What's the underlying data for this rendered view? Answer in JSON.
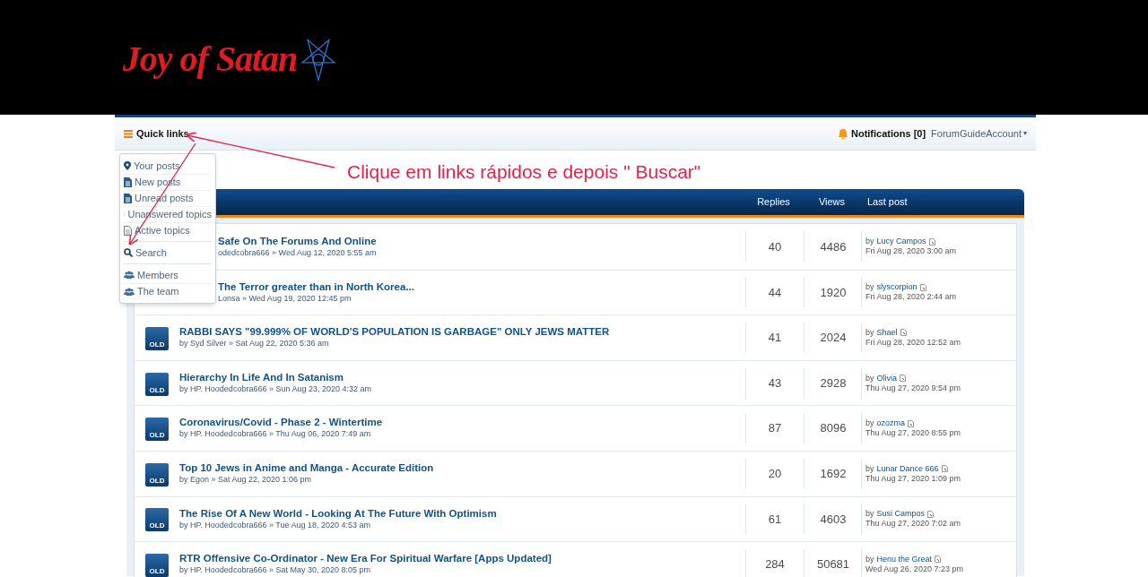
{
  "logo": {
    "text": "Joy of Satan"
  },
  "navbar": {
    "quick_links": "Quick links",
    "notifications": "Notifications [0]",
    "account": "ForumGuideAccount",
    "account_caret": "▾"
  },
  "quick_links_menu": {
    "groups": [
      [
        {
          "label": "Your posts",
          "kind": "pin"
        },
        {
          "label": "New posts",
          "kind": "filled"
        },
        {
          "label": "Unread posts",
          "kind": "filled"
        },
        {
          "label": "Unanswered topics",
          "kind": "outline"
        },
        {
          "label": "Active topics",
          "kind": "lines"
        }
      ],
      [
        {
          "label": "Search",
          "kind": "search"
        }
      ],
      [
        {
          "label": "Members",
          "kind": "users"
        },
        {
          "label": "The team",
          "kind": "users"
        }
      ]
    ]
  },
  "annotation": {
    "text": "Clique em links rápidos e depois \" Buscar\""
  },
  "table": {
    "columns": [
      "Replies",
      "Views",
      "Last post"
    ],
    "rows": [
      {
        "kind": "covered",
        "title": "Safe On The Forums And Online",
        "byline": "odedcobra666 » Wed Aug 12, 2020 5:55 am",
        "replies": "40",
        "views": "4486",
        "last_by": "by",
        "last_author": "Lucy Campos",
        "last_date": "Fri Aug 28, 2020 3:00 am"
      },
      {
        "kind": "covered",
        "title": "The Terror greater than in North Korea...",
        "byline": "Lonsa » Wed Aug 19, 2020 12:45 pm",
        "replies": "44",
        "views": "1920",
        "last_by": "by",
        "last_author": "slyscorpion",
        "last_date": "Fri Aug 28, 2020 2:44 am"
      },
      {
        "kind": "full",
        "badge": "OLD",
        "title": "RABBI SAYS \"99.999% OF WORLD'S POPULATION IS GARBAGE\" ONLY JEWS MATTER",
        "byline": "by Syd Silver » Sat Aug 22, 2020 5:36 am",
        "replies": "41",
        "views": "2024",
        "last_by": "by",
        "last_author": "Shael",
        "last_date": "Fri Aug 28, 2020 12:52 am"
      },
      {
        "kind": "full",
        "badge": "OLD",
        "title": "Hierarchy In Life And In Satanism",
        "byline": "by HP. Hoodedcobra666 » Sun Aug 23, 2020 4:32 am",
        "replies": "43",
        "views": "2928",
        "last_by": "by",
        "last_author": "Olivia",
        "last_date": "Thu Aug 27, 2020 9:54 pm"
      },
      {
        "kind": "full",
        "badge": "OLD",
        "title": "Coronavirus/Covid - Phase 2 - Wintertime",
        "byline": "by HP. Hoodedcobra666 » Thu Aug 06, 2020 7:49 am",
        "replies": "87",
        "views": "8096",
        "last_by": "by",
        "last_author": "ozozma",
        "last_date": "Thu Aug 27, 2020 8:55 pm"
      },
      {
        "kind": "full",
        "badge": "OLD",
        "title": "Top 10 Jews in Anime and Manga - Accurate Edition",
        "byline": "by Egon » Sat Aug 22, 2020 1:06 pm",
        "replies": "20",
        "views": "1692",
        "last_by": "by",
        "last_author": "Lunar Dance 666",
        "last_date": "Thu Aug 27, 2020 1:09 pm"
      },
      {
        "kind": "full",
        "badge": "OLD",
        "title": "The Rise Of A New World - Looking At The Future With Optimism",
        "byline": "by HP. Hoodedcobra666 » Tue Aug 18, 2020 4:53 am",
        "replies": "61",
        "views": "4603",
        "last_by": "by",
        "last_author": "Susi Campos",
        "last_date": "Thu Aug 27, 2020 7:02 am"
      },
      {
        "kind": "full",
        "badge": "OLD",
        "title": "RTR Offensive Co-Ordinator - New Era For Spiritual Warfare [Apps Updated]",
        "byline": "by HP. Hoodedcobra666 » Sat May 30, 2020 8:05 pm",
        "replies": "284",
        "views": "50681",
        "last_by": "by",
        "last_author": "Henu the Great",
        "last_date": "Wed Aug 26, 2020 7:23 pm"
      }
    ]
  }
}
